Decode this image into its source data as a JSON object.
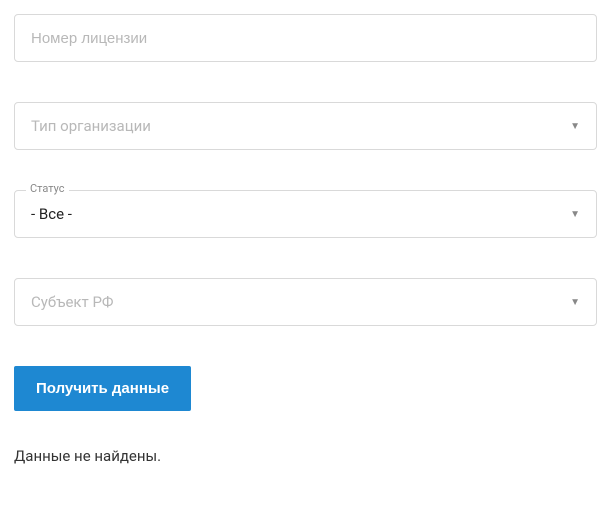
{
  "license": {
    "placeholder": "Номер лицензии",
    "value": ""
  },
  "orgType": {
    "placeholder": "Тип организации",
    "value": ""
  },
  "status": {
    "label": "Статус",
    "value": "- Все -"
  },
  "subject": {
    "placeholder": "Субъект РФ",
    "value": ""
  },
  "submit": {
    "label": "Получить данные"
  },
  "result": {
    "message": "Данные не найдены."
  }
}
